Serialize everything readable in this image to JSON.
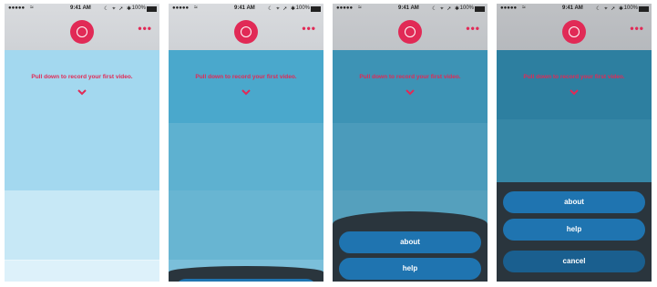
{
  "status_bar": {
    "signal": "●●●●●",
    "wifi": "≈",
    "time": "9:41 AM",
    "icons": "☾ ⌖ ➚ ✱",
    "battery": "100%"
  },
  "header": {
    "record_icon": "record-camera-icon",
    "more_dots": "•••"
  },
  "prompt": {
    "text": "Pull down to record your first video."
  },
  "sheet": {
    "about_label": "about",
    "help_label": "help",
    "cancel_label": "cancel"
  },
  "colors": {
    "accent": "#e12a56",
    "button": "#1f74b0",
    "sheet_bg": "#2a353d"
  }
}
